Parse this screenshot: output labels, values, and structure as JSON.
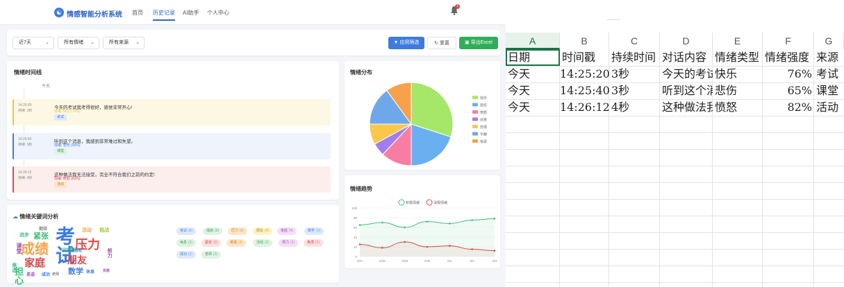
{
  "nav": {
    "logo_glyph": "☯",
    "brand": "情感智能分析系统",
    "links": [
      "首页",
      "历史记录",
      "AI助手",
      "个人中心"
    ],
    "active_index": 1,
    "bell_count": "1"
  },
  "filters": {
    "range": "近7天",
    "emotion": "所有情绪",
    "source": "所有来源",
    "apply": "应用筛选",
    "reset": "重置",
    "export": "导出Excel"
  },
  "timeline": {
    "title": "情绪时间线",
    "day": "今天",
    "events": [
      {
        "time": "14:25:20",
        "duration": "持续: 3秒",
        "text": "今天的考试我考得很好，感觉非常开心!",
        "emotion": "情绪: 快乐 (76%)",
        "tag": "考试",
        "color": "#f0c33c",
        "bg": "#fdf8e4",
        "tagbg": "#dfe9fb",
        "tagfg": "#3d7be0"
      },
      {
        "time": "14:25:40",
        "duration": "持续: 3秒",
        "text": "听到这个消息，我感到非常难过和失望。",
        "emotion": "情绪: 悲伤 (65%)",
        "tag": "课堂",
        "color": "#3d7be0",
        "bg": "#eef3fc",
        "tagbg": "#dff3e3",
        "tagfg": "#3a9a4e"
      },
      {
        "time": "14:26:12",
        "duration": "持续: 4秒",
        "text": "这种做法我无法接受，完全不符合我们之前的约定!",
        "emotion": "情绪: 愤怒 (82%)",
        "tag": "活动",
        "color": "#e04848",
        "bg": "#fdeeee",
        "tagbg": "#fde6c8",
        "tagfg": "#d4781c"
      }
    ]
  },
  "keywords": {
    "title": "情绪关键词分析",
    "cloud": [
      "考试",
      "成绩",
      "压力",
      "朋友",
      "家庭",
      "紧张",
      "数学",
      "活动",
      "挑战",
      "进步",
      "努力",
      "休息",
      "失败",
      "焦虑",
      "成功",
      "老师",
      "课堂",
      "担心",
      "期待",
      "英语",
      "同学关系",
      "放松"
    ],
    "chips": [
      {
        "label": "考试",
        "count": "(8)",
        "bg": "#dfe9fb",
        "fg": "#3d7be0"
      },
      {
        "label": "成绩",
        "count": "(6)",
        "bg": "#dff3e3",
        "fg": "#3a9a4e"
      },
      {
        "label": "压力",
        "count": "(5)",
        "bg": "#fde6c8",
        "fg": "#d4781c"
      },
      {
        "label": "朋友",
        "count": "(4)",
        "bg": "#fdf2c2",
        "fg": "#b58a10"
      },
      {
        "label": "家庭",
        "count": "(4)",
        "bg": "#f4dff7",
        "fg": "#a04cb8"
      },
      {
        "label": "数学",
        "count": "(3)",
        "bg": "#dfe9fb",
        "fg": "#3d7be0"
      },
      {
        "label": "休息",
        "count": "(3)",
        "bg": "#dff3e3",
        "fg": "#3a9a4e"
      },
      {
        "label": "紧张",
        "count": "(3)",
        "bg": "#fde0e0",
        "fg": "#d44848"
      },
      {
        "label": "英语",
        "count": "(2)",
        "bg": "#fde6c8",
        "fg": "#d4781c"
      },
      {
        "label": "活动",
        "count": "(2)",
        "bg": "#dff3e3",
        "fg": "#3a9a4e"
      },
      {
        "label": "努力",
        "count": "(2)",
        "bg": "#f4dff7",
        "fg": "#a04cb8"
      },
      {
        "label": "焦虑",
        "count": "(2)",
        "bg": "#fde0e0",
        "fg": "#d44848"
      },
      {
        "label": "成功",
        "count": "(2)",
        "bg": "#dfe9fb",
        "fg": "#3d7be0"
      },
      {
        "label": "老师",
        "count": "(2)",
        "bg": "#dff3e3",
        "fg": "#3a9a4e"
      }
    ]
  },
  "distribution": {
    "title": "情绪分布",
    "chart_data": {
      "type": "pie",
      "series": [
        {
          "name": "快乐",
          "value": 30,
          "color": "#a6e76a"
        },
        {
          "name": "悲伤",
          "value": 20,
          "color": "#6ab0f0"
        },
        {
          "name": "愤怒",
          "value": 12,
          "color": "#f77ea2"
        },
        {
          "name": "厌恶",
          "value": 5,
          "color": "#a17df0"
        },
        {
          "name": "恐惧",
          "value": 8,
          "color": "#f9c84a"
        },
        {
          "name": "平静",
          "value": 15,
          "color": "#6fa8ea"
        },
        {
          "name": "惊讶",
          "value": 10,
          "color": "#f7a24a"
        }
      ]
    }
  },
  "trend": {
    "title": "情绪趋势",
    "chart_data": {
      "type": "line",
      "x": [
        "4/27",
        "4/28",
        "4/29",
        "4/30",
        "5/1",
        "5/2",
        "5/3"
      ],
      "ylim": [
        0,
        100
      ],
      "yticks": [
        0,
        20,
        40,
        60,
        80,
        100
      ],
      "series": [
        {
          "name": "积极情绪",
          "values": [
            65,
            70,
            60,
            72,
            68,
            75,
            78
          ],
          "color": "#3cbf78"
        },
        {
          "name": "消极情绪",
          "values": [
            25,
            18,
            30,
            20,
            22,
            15,
            12
          ],
          "color": "#d84848"
        }
      ]
    }
  },
  "sheet": {
    "columns": [
      "A",
      "B",
      "C",
      "D",
      "E",
      "F",
      "G"
    ],
    "rows": [
      [
        "日期",
        "时间戳",
        "持续时间",
        "对话内容",
        "情绪类型",
        "情绪强度",
        "来源"
      ],
      [
        "今天",
        "14:25:20",
        "3秒",
        "今天的考试",
        "快乐",
        "76%",
        "考试"
      ],
      [
        "今天",
        "14:25:40",
        "3秒",
        "听到这个消",
        "悲伤",
        "65%",
        "课堂"
      ],
      [
        "今天",
        "14:26:12",
        "4秒",
        "这种做法我",
        "愤怒",
        "82%",
        "活动"
      ]
    ]
  }
}
